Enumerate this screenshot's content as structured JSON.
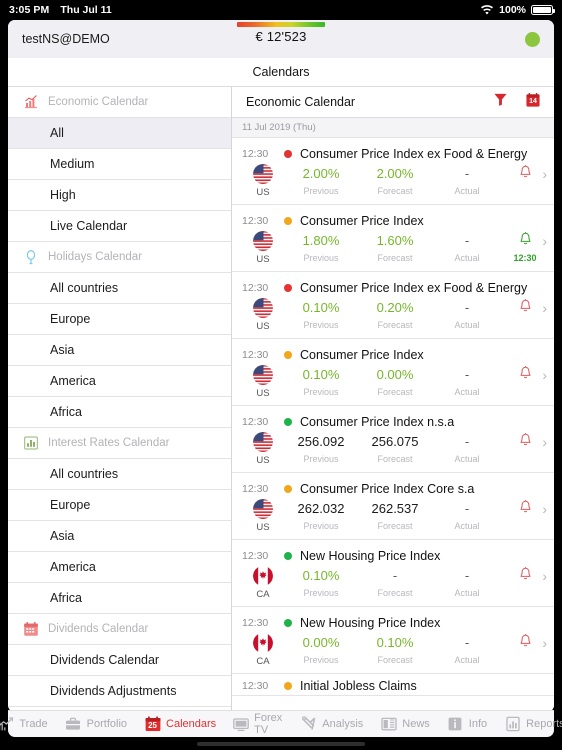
{
  "statusbar": {
    "time": "3:05 PM",
    "date": "Thu Jul 11",
    "wifi_icon": "wifi-icon",
    "battery_pct": "100%",
    "battery_icon": "battery-icon"
  },
  "account_bar": {
    "account_name": "testNS@DEMO",
    "balance": "€ 12'523",
    "gradient_name": "risk-gradient-bar",
    "status_indicator": "connection-status-dot",
    "status_color": "#8cc63f"
  },
  "navbar": {
    "title": "Calendars"
  },
  "sidebar": {
    "sections": [
      {
        "title": "Economic Calendar",
        "icon": "economic-chart-icon",
        "items": [
          {
            "label": "All",
            "selected": true
          },
          {
            "label": "Medium",
            "selected": false
          },
          {
            "label": "High",
            "selected": false
          },
          {
            "label": "Live Calendar",
            "selected": false
          }
        ]
      },
      {
        "title": "Holidays Calendar",
        "icon": "balloon-icon",
        "items": [
          {
            "label": "All countries",
            "selected": false
          },
          {
            "label": "Europe",
            "selected": false
          },
          {
            "label": "Asia",
            "selected": false
          },
          {
            "label": "America",
            "selected": false
          },
          {
            "label": "Africa",
            "selected": false
          }
        ]
      },
      {
        "title": "Interest Rates Calendar",
        "icon": "bar-chart-icon",
        "items": [
          {
            "label": "All countries",
            "selected": false
          },
          {
            "label": "Europe",
            "selected": false
          },
          {
            "label": "Asia",
            "selected": false
          },
          {
            "label": "America",
            "selected": false
          },
          {
            "label": "Africa",
            "selected": false
          }
        ]
      },
      {
        "title": "Dividends Calendar",
        "icon": "calendar-icon",
        "items": [
          {
            "label": "Dividends Calendar",
            "selected": false
          },
          {
            "label": "Dividends Adjustments",
            "selected": false
          }
        ]
      }
    ]
  },
  "content": {
    "title": "Economic Calendar",
    "filter_icon": "filter-funnel-icon",
    "calendar_icon": "calendar-date-icon",
    "calendar_icon_day": "14",
    "date_header": "11 Jul 2019 (Thu)",
    "column_labels": {
      "previous": "Previous",
      "forecast": "Forecast",
      "actual": "Actual"
    },
    "events": [
      {
        "time": "12:30",
        "importance": "high",
        "importance_color": "#e3342f",
        "name": "Consumer Price Index ex Food & Energy",
        "country": "US",
        "flag": "flag-us",
        "previous": "2.00%",
        "previous_style": "green",
        "forecast": "2.00%",
        "forecast_style": "green",
        "actual": "-",
        "actual_style": "dash",
        "alert": "bell-icon",
        "alert_state": "off",
        "alert_time": ""
      },
      {
        "time": "12:30",
        "importance": "medium",
        "importance_color": "#f0a71c",
        "name": "Consumer Price Index",
        "country": "US",
        "flag": "flag-us",
        "previous": "1.80%",
        "previous_style": "green",
        "forecast": "1.60%",
        "forecast_style": "green",
        "actual": "-",
        "actual_style": "dash",
        "alert": "bell-icon",
        "alert_state": "on",
        "alert_time": "12:30"
      },
      {
        "time": "12:30",
        "importance": "high",
        "importance_color": "#e3342f",
        "name": "Consumer Price Index ex Food & Energy",
        "country": "US",
        "flag": "flag-us",
        "previous": "0.10%",
        "previous_style": "green",
        "forecast": "0.20%",
        "forecast_style": "green",
        "actual": "-",
        "actual_style": "dash",
        "alert": "bell-icon",
        "alert_state": "off",
        "alert_time": ""
      },
      {
        "time": "12:30",
        "importance": "medium",
        "importance_color": "#f0a71c",
        "name": "Consumer Price Index",
        "country": "US",
        "flag": "flag-us",
        "previous": "0.10%",
        "previous_style": "green",
        "forecast": "0.00%",
        "forecast_style": "green",
        "actual": "-",
        "actual_style": "dash",
        "alert": "bell-icon",
        "alert_state": "off",
        "alert_time": ""
      },
      {
        "time": "12:30",
        "importance": "low",
        "importance_color": "#20b24a",
        "name": "Consumer Price Index n.s.a",
        "country": "US",
        "flag": "flag-us",
        "previous": "256.092",
        "previous_style": "dark",
        "forecast": "256.075",
        "forecast_style": "dark",
        "actual": "-",
        "actual_style": "dash",
        "alert": "bell-icon",
        "alert_state": "off",
        "alert_time": ""
      },
      {
        "time": "12:30",
        "importance": "medium",
        "importance_color": "#f0a71c",
        "name": "Consumer Price Index Core s.a",
        "country": "US",
        "flag": "flag-us",
        "previous": "262.032",
        "previous_style": "dark",
        "forecast": "262.537",
        "forecast_style": "dark",
        "actual": "-",
        "actual_style": "dash",
        "alert": "bell-icon",
        "alert_state": "off",
        "alert_time": ""
      },
      {
        "time": "12:30",
        "importance": "low",
        "importance_color": "#20b24a",
        "name": "New Housing Price Index",
        "country": "CA",
        "flag": "flag-ca",
        "previous": "0.10%",
        "previous_style": "green",
        "forecast": "-",
        "forecast_style": "dash",
        "actual": "-",
        "actual_style": "dash",
        "alert": "bell-icon",
        "alert_state": "off",
        "alert_time": ""
      },
      {
        "time": "12:30",
        "importance": "low",
        "importance_color": "#20b24a",
        "name": "New Housing Price Index",
        "country": "CA",
        "flag": "flag-ca",
        "previous": "0.00%",
        "previous_style": "green",
        "forecast": "0.10%",
        "forecast_style": "green",
        "actual": "-",
        "actual_style": "dash",
        "alert": "bell-icon",
        "alert_state": "off",
        "alert_time": ""
      },
      {
        "time": "12:30",
        "importance": "medium",
        "importance_color": "#f0a71c",
        "name": "Initial Jobless Claims",
        "country": "",
        "flag": "",
        "previous": "",
        "previous_style": "dash",
        "forecast": "",
        "forecast_style": "dash",
        "actual": "",
        "actual_style": "dash",
        "alert": "",
        "alert_state": "off",
        "alert_time": ""
      }
    ]
  },
  "tabbar": {
    "items": [
      {
        "label": "Trade",
        "icon": "trade-chart-icon",
        "active": false
      },
      {
        "label": "Portfolio",
        "icon": "briefcase-icon",
        "active": false
      },
      {
        "label": "Calendars",
        "icon": "calendar-icon",
        "icon_day": "25",
        "active": true
      },
      {
        "label": "Forex TV",
        "icon": "tv-icon",
        "active": false
      },
      {
        "label": "Analysis",
        "icon": "tools-icon",
        "active": false
      },
      {
        "label": "News",
        "icon": "news-icon",
        "active": false
      },
      {
        "label": "Info",
        "icon": "info-icon",
        "active": false
      },
      {
        "label": "Reports",
        "icon": "reports-chart-icon",
        "active": false
      }
    ]
  }
}
